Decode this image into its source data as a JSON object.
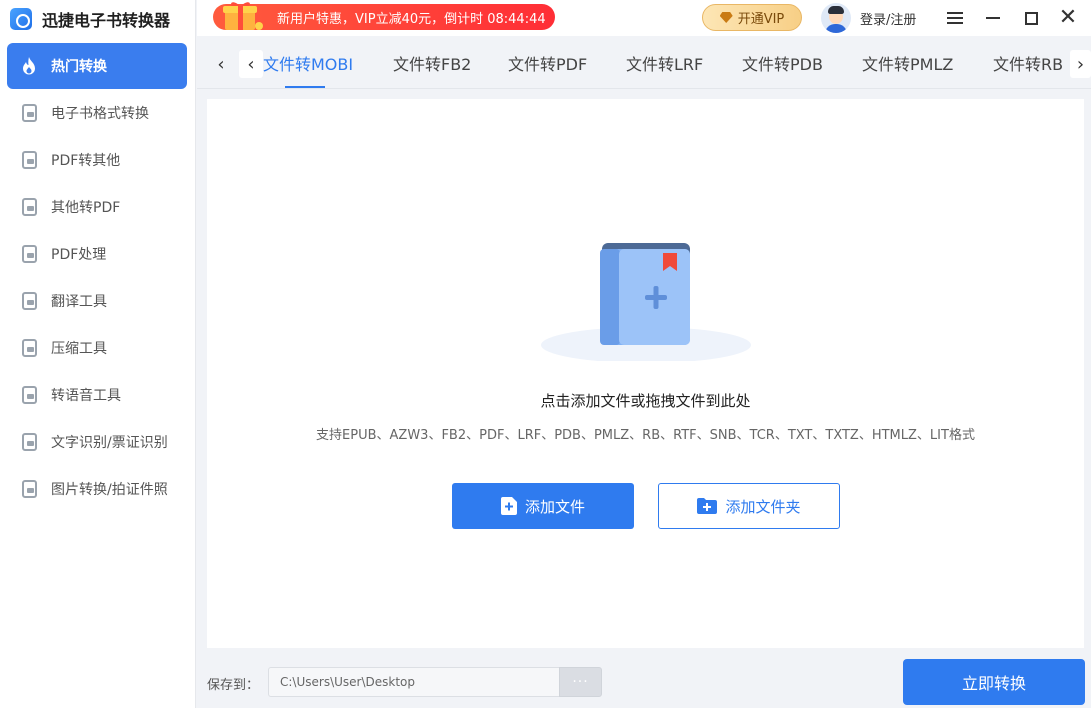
{
  "app": {
    "name": "迅捷电子书转换器"
  },
  "sidebar": {
    "items": [
      {
        "label": "热门转换",
        "icon": "flame-icon",
        "active": true
      },
      {
        "label": "电子书格式转换",
        "icon": "ebook-convert-icon"
      },
      {
        "label": "PDF转其他",
        "icon": "pdf-to-other-icon"
      },
      {
        "label": "其他转PDF",
        "icon": "other-to-pdf-icon"
      },
      {
        "label": "PDF处理",
        "icon": "pdf-edit-icon"
      },
      {
        "label": "翻译工具",
        "icon": "translate-icon"
      },
      {
        "label": "压缩工具",
        "icon": "compress-icon"
      },
      {
        "label": "转语音工具",
        "icon": "speech-icon"
      },
      {
        "label": "文字识别/票证识别",
        "icon": "ocr-icon"
      },
      {
        "label": "图片转换/拍证件照",
        "icon": "image-icon"
      }
    ]
  },
  "topbar": {
    "promo": "新用户特惠，VIP立减40元，倒计时 08:44:44",
    "vip": "开通VIP",
    "login": "登录/注册"
  },
  "tabs": {
    "items": [
      "文件转MOBI",
      "文件转FB2",
      "文件转PDF",
      "文件转LRF",
      "文件转PDB",
      "文件转PMLZ",
      "文件转RB"
    ],
    "active_index": 0
  },
  "dropzone": {
    "title": "点击添加文件或拖拽文件到此处",
    "formats": "支持EPUB、AZW3、FB2、PDF、LRF、PDB、PMLZ、RB、RTF、SNB、TCR、TXT、TXTZ、HTMLZ、LIT格式",
    "add_file": "添加文件",
    "add_folder": "添加文件夹"
  },
  "bottom": {
    "save_label": "保存到：",
    "path": "C:\\Users\\User\\Desktop",
    "browse": "···",
    "convert": "立即转换"
  },
  "colors": {
    "accent": "#2f7bef",
    "promo": "#ff3b36",
    "vip_gold": "#f7cf86"
  }
}
